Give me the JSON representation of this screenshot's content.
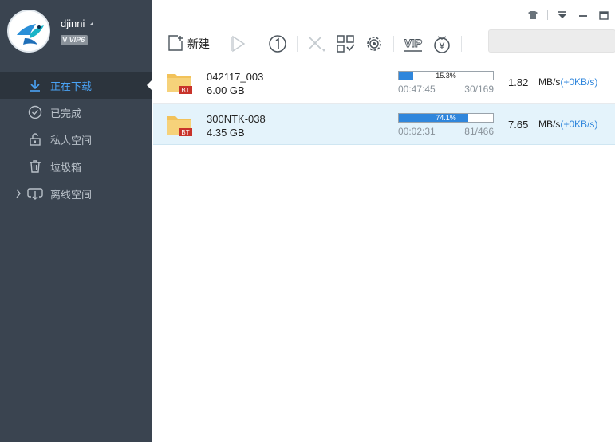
{
  "user": {
    "name": "djinni",
    "vip_badge": "VIP6",
    "vip_letter": "V"
  },
  "sidebar": {
    "items": [
      {
        "label": "正在下载",
        "icon": "download-arrow-icon",
        "active": true
      },
      {
        "label": "已完成",
        "icon": "check-circle-icon",
        "active": false
      },
      {
        "label": "私人空间",
        "icon": "lock-icon",
        "active": false
      },
      {
        "label": "垃圾箱",
        "icon": "trash-icon",
        "active": false
      },
      {
        "label": "离线空间",
        "icon": "cloud-download-icon",
        "active": false
      }
    ]
  },
  "toolbar": {
    "new_label": "新建",
    "icons": [
      "new-task-icon",
      "play-icon",
      "speed-limit-icon",
      "delete-icon",
      "qr-code-icon",
      "settings-gear-icon",
      "vip-icon",
      "coin-icon"
    ],
    "vip_label": "VIP",
    "coin_symbol": "¥"
  },
  "window_controls": [
    "skin-shirt-icon",
    "menu-dropdown-icon",
    "minimize-icon",
    "maximize-icon"
  ],
  "tasks": [
    {
      "name": "042117_003",
      "size": "6.00 GB",
      "type_badge": "BT",
      "progress": 15.3,
      "progress_text": "15.3%",
      "time_left": "00:47:45",
      "pieces": "30/169",
      "speed": "1.82",
      "speed_unit": "MB/s",
      "upload": "(+0KB/s)",
      "selected": false
    },
    {
      "name": "300NTK-038",
      "size": "4.35 GB",
      "type_badge": "BT",
      "progress": 74.1,
      "progress_text": "74.1%",
      "time_left": "00:02:31",
      "pieces": "81/466",
      "speed": "7.65",
      "speed_unit": "MB/s",
      "upload": "(+0KB/s)",
      "selected": true
    }
  ],
  "colors": {
    "sidebar_bg": "#3a4450",
    "accent_blue": "#2f86dc",
    "active_text": "#4aa3f5",
    "folder_yellow": "#f2c25a",
    "bt_badge_red": "#c8332b"
  }
}
